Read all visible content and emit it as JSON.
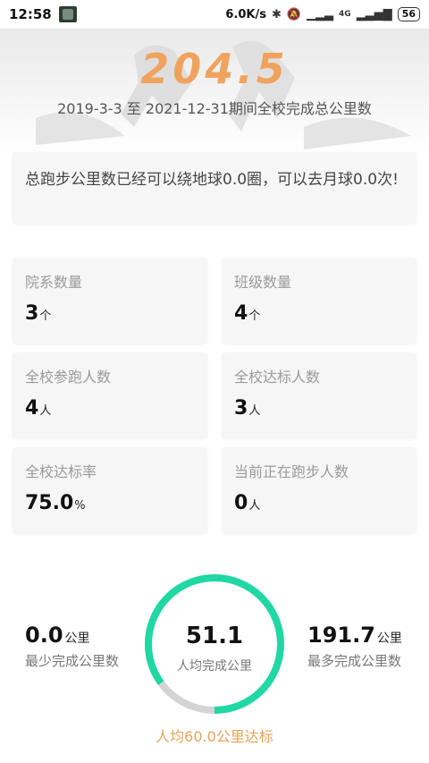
{
  "status_bar": {
    "time": "12:58",
    "speed": "6.0K/s",
    "network": "4G",
    "battery": "56"
  },
  "hero": {
    "total_km": "204.5",
    "period_text": "2019-3-3 至 2021-12-31期间全校完成总公里数"
  },
  "summary": {
    "text": "总跑步公里数已经可以绕地球0.0圈，可以去月球0.0次!"
  },
  "stats": [
    {
      "label": "院系数量",
      "value": "3",
      "unit": "个"
    },
    {
      "label": "班级数量",
      "value": "4",
      "unit": "个"
    },
    {
      "label": "全校参跑人数",
      "value": "4",
      "unit": "人"
    },
    {
      "label": "全校达标人数",
      "value": "3",
      "unit": "人"
    },
    {
      "label": "全校达标率",
      "value": "75.0",
      "unit": "%"
    },
    {
      "label": "当前正在跑步人数",
      "value": "0",
      "unit": "人"
    }
  ],
  "per_capita": {
    "min_value": "0.0",
    "min_unit": "公里",
    "min_label": "最少完成公里数",
    "avg_value": "51.1",
    "avg_label": "人均完成公里",
    "max_value": "191.7",
    "max_unit": "公里",
    "max_label": "最多完成公里数",
    "target_text": "人均60.0公里达标",
    "progress_fraction": 0.85,
    "ring_color": "#1fd8a4",
    "ring_track_color": "#d4d4d4"
  }
}
